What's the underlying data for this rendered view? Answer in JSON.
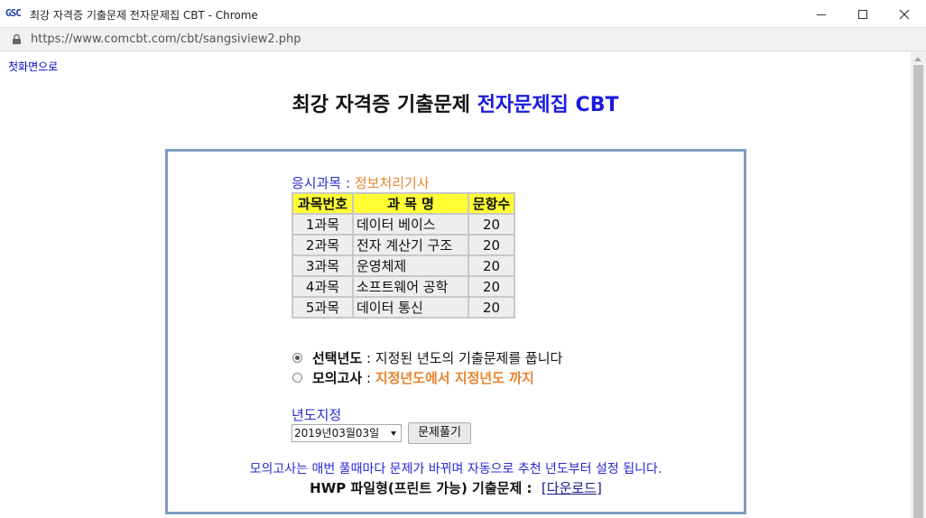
{
  "window": {
    "logo": "GSC",
    "title": "최강 자격증 기출문제 전자문제집 CBT - Chrome",
    "url": "https://www.comcbt.com/cbt/sangsiview2.php"
  },
  "page": {
    "home_link": "첫화면으로",
    "title_main": "최강 자격증 기출문제",
    "title_accent": "전자문제집 CBT"
  },
  "exam": {
    "subject_label": "응시과목 :",
    "subject_name": "정보처리기사"
  },
  "table": {
    "headers": [
      "과목번호",
      "과 목 명",
      "문항수"
    ],
    "rows": [
      {
        "num": "1과목",
        "name": "데이터 베이스",
        "count": "20"
      },
      {
        "num": "2과목",
        "name": "전자 계산기 구조",
        "count": "20"
      },
      {
        "num": "3과목",
        "name": "운영체제",
        "count": "20"
      },
      {
        "num": "4과목",
        "name": "소프트웨어 공학",
        "count": "20"
      },
      {
        "num": "5과목",
        "name": "데이터 통신",
        "count": "20"
      }
    ]
  },
  "options": {
    "selected_year_label": "선택년도",
    "selected_year_desc": " : 지정된 년도의 기출문제를 풉니다",
    "mock_label": "모의고사",
    "mock_sep": " : ",
    "mock_desc": "지정년도에서 지정년도 까지",
    "selected": "selected_year"
  },
  "year": {
    "label": "년도지정",
    "value": "2019년03월03일",
    "solve_button": "문제풀기"
  },
  "footer": {
    "notice": "모의고사는 매번 풀때마다 문제가 바뀌며 자동으로 추천 년도부터 설정 됩니다.",
    "hwp_label": "HWP 파일형(프린트 가능) 기출문제 : ",
    "download": "[다운로드]"
  }
}
